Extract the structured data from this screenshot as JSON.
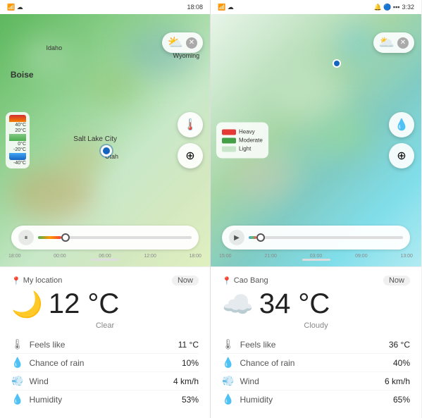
{
  "left_phone": {
    "status_time": "18:08",
    "map_labels": [
      "Idaho",
      "Boise",
      "Wyoming",
      "Salt Lake City",
      "Utah"
    ],
    "temp_scale": [
      "40°C",
      "20°C",
      "0°C",
      "-20°C",
      "-40°C"
    ],
    "timeline_times": [
      "18:00",
      "00:00",
      "06:00",
      "12:00",
      "18:00"
    ],
    "slider_position": "15%",
    "weather_icon": "⛅",
    "location": "My location",
    "now_label": "Now",
    "temperature": "12 °C",
    "condition": "Clear",
    "feels_like_label": "Feels like",
    "feels_like_value": "11 °C",
    "chance_rain_label": "Chance of rain",
    "chance_rain_value": "10%",
    "wind_label": "Wind",
    "wind_value": "4 km/h",
    "humidity_label": "Humidity",
    "humidity_value": "53%"
  },
  "right_phone": {
    "status_time": "3:32",
    "legend_heavy": "Heavy",
    "legend_moderate": "Moderate",
    "legend_light": "Light",
    "timeline_times": [
      "15:00",
      "21:00",
      "03:00",
      "09:00",
      "13:00"
    ],
    "slider_position": "5%",
    "weather_icon": "🌥️",
    "location": "Cao Bang",
    "now_label": "Now",
    "temperature": "34 °C",
    "condition": "Cloudy",
    "feels_like_label": "Feels like",
    "feels_like_value": "36 °C",
    "chance_rain_label": "Chance of rain",
    "chance_rain_value": "40%",
    "wind_label": "Wind",
    "wind_value": "6 km/h",
    "humidity_label": "Humidity",
    "humidity_value": "65%"
  },
  "icons": {
    "location_pin": "📍",
    "thermometer": "🌡",
    "rain_drop": "💧",
    "wind": "💨",
    "humidity": "💧",
    "close": "✕",
    "pause": "⏸",
    "play": "▶",
    "target": "⊕",
    "moon": "🌙",
    "cloud": "☁️"
  }
}
